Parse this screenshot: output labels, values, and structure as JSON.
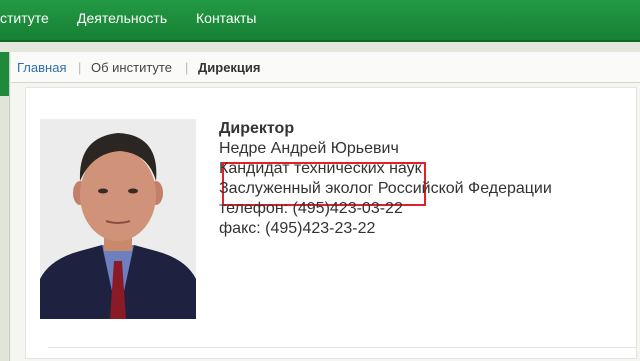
{
  "nav": {
    "items": [
      "ституте",
      "Деятельность",
      "Контакты"
    ]
  },
  "breadcrumb": {
    "home": "Главная",
    "separator": "|",
    "about": "Об институте",
    "current": "Дирекция"
  },
  "person": {
    "position": "Директор",
    "name": "Недре Андрей Юрьевич",
    "degree": "Кандидат технических наук",
    "honor": "Заслуженный эколог Российской Федерации",
    "phone": "телефон: (495)423-03-22",
    "fax": "факс: (495)423-23-22"
  },
  "colors": {
    "nav_green": "#1f8a3c",
    "link_blue": "#2f6fb0",
    "highlight_red": "#e0202a"
  }
}
